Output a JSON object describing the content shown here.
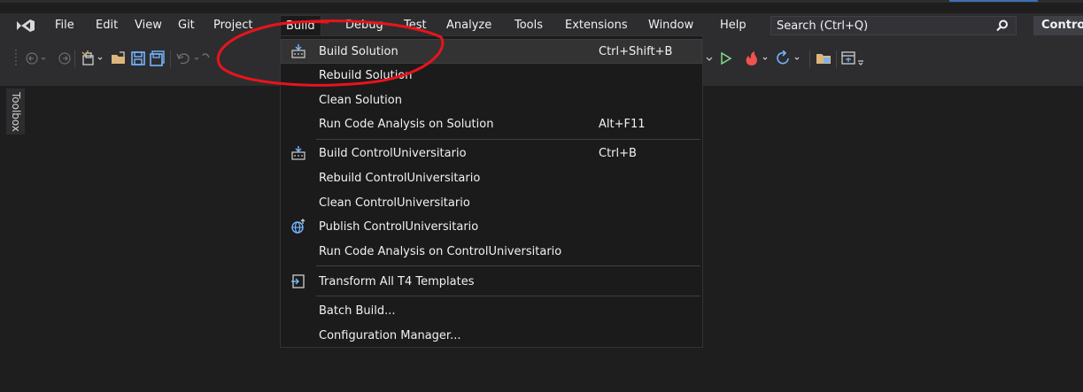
{
  "menubar": {
    "items": [
      "File",
      "Edit",
      "View",
      "Git",
      "Project",
      "Build",
      "Debug",
      "Test",
      "Analyze",
      "Tools",
      "Extensions",
      "Window",
      "Help"
    ],
    "search_placeholder": "Search (Ctrl+Q)",
    "project_name": "Contro"
  },
  "toolbox": {
    "label": "Toolbox"
  },
  "build_menu": {
    "items": [
      {
        "label": "Build Solution",
        "shortcut": "Ctrl+Shift+B",
        "icon": "build-icon"
      },
      {
        "label": "Rebuild Solution",
        "shortcut": "",
        "icon": ""
      },
      {
        "label": "Clean Solution",
        "shortcut": "",
        "icon": ""
      },
      {
        "label": "Run Code Analysis on Solution",
        "shortcut": "Alt+F11",
        "icon": ""
      },
      {
        "label": "Build ControlUniversitario",
        "shortcut": "Ctrl+B",
        "icon": "build-icon"
      },
      {
        "label": "Rebuild ControlUniversitario",
        "shortcut": "",
        "icon": ""
      },
      {
        "label": "Clean ControlUniversitario",
        "shortcut": "",
        "icon": ""
      },
      {
        "label": "Publish ControlUniversitario",
        "shortcut": "",
        "icon": "globe-icon"
      },
      {
        "label": "Run Code Analysis on ControlUniversitario",
        "shortcut": "",
        "icon": ""
      },
      {
        "label": "Transform All T4 Templates",
        "shortcut": "",
        "icon": "transform-icon"
      },
      {
        "label": "Batch Build...",
        "shortcut": "",
        "icon": ""
      },
      {
        "label": "Configuration Manager...",
        "shortcut": "",
        "icon": ""
      }
    ]
  },
  "colors": {
    "background": "#1e1e1e",
    "chrome": "#2d2d30",
    "menu_bg": "#1b1b1c",
    "highlight": "#333334",
    "annotation": "#e8141b"
  }
}
